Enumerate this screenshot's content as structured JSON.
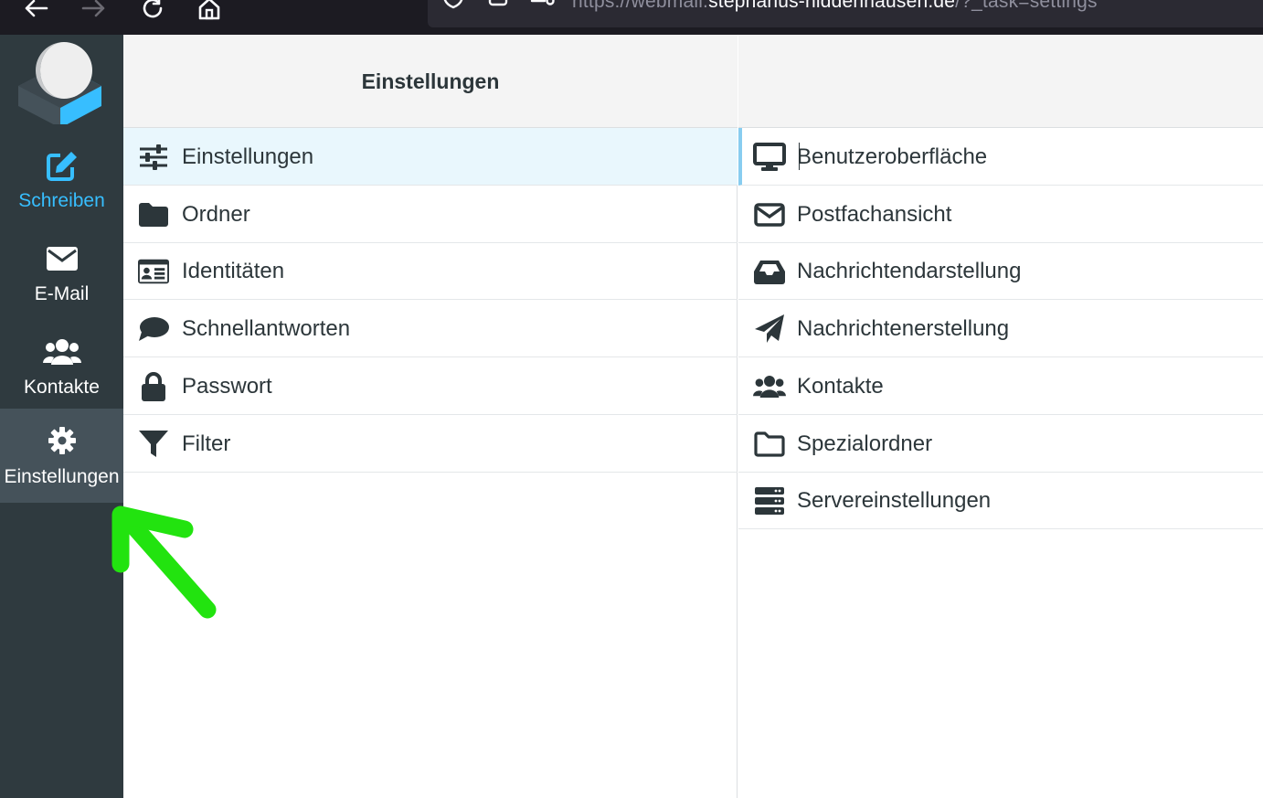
{
  "browser": {
    "url_prefix": "https://webmail.",
    "url_domain": "stephanus-hiddenhausen.de",
    "url_suffix": "/?_task=settings",
    "icons": [
      "back-arrow-icon",
      "forward-arrow-icon",
      "reload-icon",
      "home-icon",
      "shield-icon",
      "tab-icon",
      "permissions-icon"
    ]
  },
  "taskmenu": {
    "logo_icon": "roundcube-logo",
    "items": [
      {
        "label": "Schreiben",
        "icon": "compose-icon",
        "color": "#37beff"
      },
      {
        "label": "E-Mail",
        "icon": "envelope-icon"
      },
      {
        "label": "Kontakte",
        "icon": "users-icon"
      },
      {
        "label": "Einstellungen",
        "icon": "gear-icon",
        "active": true
      }
    ]
  },
  "settings": {
    "title": "Einstellungen",
    "items": [
      {
        "label": "Einstellungen",
        "icon": "sliders-icon",
        "selected": true
      },
      {
        "label": "Ordner",
        "icon": "folder-icon"
      },
      {
        "label": "Identitäten",
        "icon": "id-card-icon"
      },
      {
        "label": "Schnellantworten",
        "icon": "speech-bubble-icon"
      },
      {
        "label": "Passwort",
        "icon": "lock-icon"
      },
      {
        "label": "Filter",
        "icon": "filter-icon"
      }
    ]
  },
  "sections": {
    "items": [
      {
        "label": "Benutzeroberfläche",
        "icon": "monitor-icon",
        "selected": true
      },
      {
        "label": "Postfachansicht",
        "icon": "envelope-outline-icon"
      },
      {
        "label": "Nachrichtendarstellung",
        "icon": "inbox-icon"
      },
      {
        "label": "Nachrichtenerstellung",
        "icon": "paper-plane-icon"
      },
      {
        "label": "Kontakte",
        "icon": "users-icon"
      },
      {
        "label": "Spezialordner",
        "icon": "folder-outline-icon"
      },
      {
        "label": "Servereinstellungen",
        "icon": "server-icon"
      }
    ]
  },
  "colors": {
    "taskmenu_bg": "#2f3a3f",
    "taskmenu_active_bg": "#45525a",
    "accent": "#37beff",
    "selected_row_bg": "#e9f7fd",
    "annotation": "#22e30f"
  }
}
